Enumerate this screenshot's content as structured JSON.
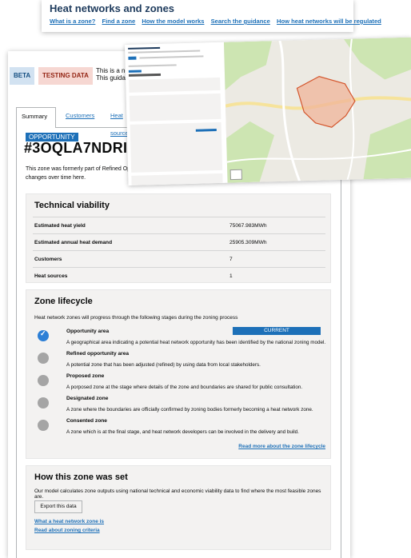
{
  "nav": {
    "title": "Heat networks and zones",
    "links": [
      "What is a zone?",
      "Find a zone",
      "How the model works",
      "Search the guidance",
      "How heat networks will be regulated"
    ]
  },
  "banner": {
    "beta": "BETA",
    "testing": "TESTING DATA",
    "text_line1": "This is a new serv",
    "text_line2": "This guidance are"
  },
  "tabs": [
    "Summary",
    "Customers",
    "Heat sources"
  ],
  "zone": {
    "tag": "OPPORTUNITY",
    "id": "#3OQLA7NDRIP-1",
    "description_line1": "This zone was formerly part of Refined Oppor",
    "description_line2": "changes over time here."
  },
  "technical": {
    "heading": "Technical viability",
    "rows": [
      {
        "label": "Estimated heat yield",
        "value": "75067.983MWh"
      },
      {
        "label": "Estimated annual heat demand",
        "value": "25905.309MWh"
      },
      {
        "label": "Customers",
        "value": "7"
      },
      {
        "label": "Heat sources",
        "value": "1"
      }
    ]
  },
  "lifecycle": {
    "heading": "Zone lifecycle",
    "intro": "Heat network zones will progress through the following stages during the zoning process",
    "current_label": "CURRENT",
    "stages": [
      {
        "name": "Opportunity area",
        "desc": "A geographical area indicating a potential heat network opportunity has been identified by the national zoning model.",
        "done": true
      },
      {
        "name": "Refined opportunity area",
        "desc": "A potential zone that has been adjusted (refined) by using data from local stakeholders.",
        "done": false
      },
      {
        "name": "Proposed zone",
        "desc": "A porposed zone at the stage where details of the zone and boundaries are shared for public consultation.",
        "done": false
      },
      {
        "name": "Designated zone",
        "desc": "A zone where the boundaries are officially confirmed by zoning bodies formerly becoming a heat network zone.",
        "done": false
      },
      {
        "name": "Consented zone",
        "desc": "A zone which is at the final stage, and heat network developers can be involved in the delivery and build.",
        "done": false
      }
    ],
    "more_link": "Read more about the zone lifecycle"
  },
  "how": {
    "heading": "How this zone was set",
    "intro": "Our model calculates zone outputs using national technical and economic viability data to find where the most feasible zones are.",
    "export": "Export this data",
    "links": [
      "What a heat network zone is",
      "Read about zoning criteria"
    ]
  },
  "colors": {
    "link": "#1d70b8",
    "zone_fill": "#f0b49a",
    "zone_stroke": "#d4562d",
    "woodland": "#cde5b2",
    "road_major": "#f6e39b"
  }
}
